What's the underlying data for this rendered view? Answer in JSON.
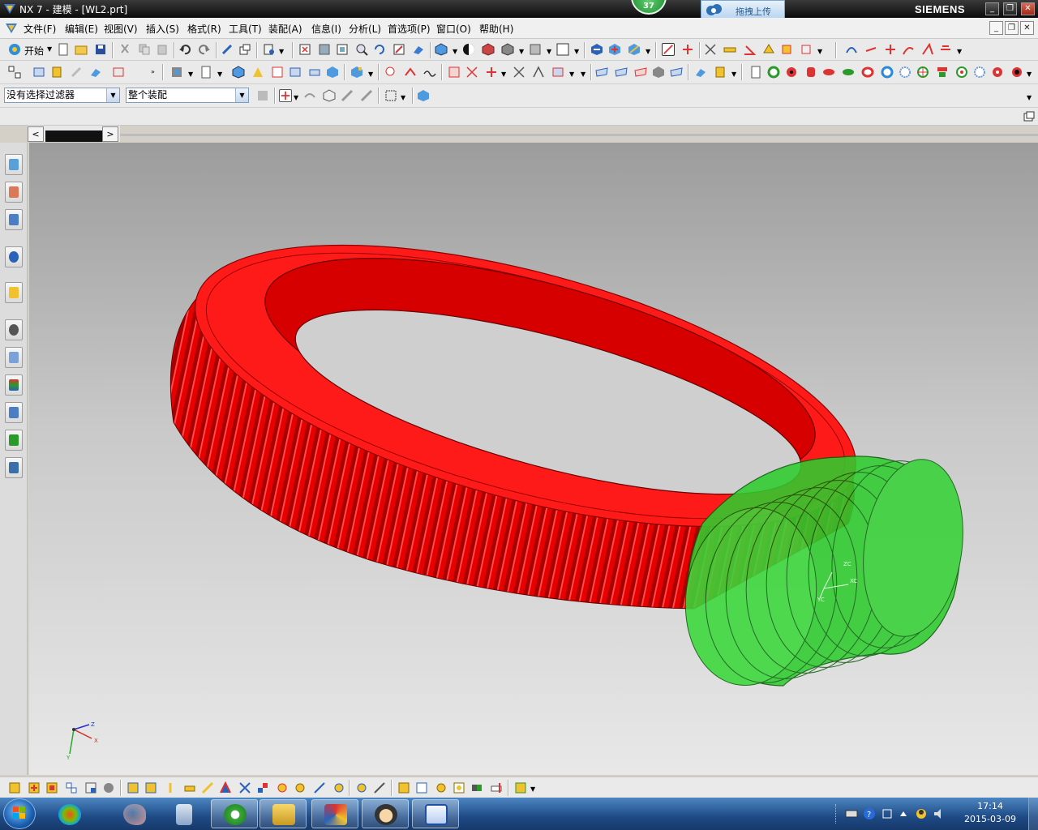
{
  "window": {
    "title": "NX 7 - 建模 - [WL2.prt]",
    "brand": "SIEMENS",
    "notification_count": "37",
    "upload_label": "拖拽上传",
    "controls": {
      "minimize": "_",
      "restore": "❐",
      "close": "✕"
    }
  },
  "menubar": {
    "items": [
      "文件(F)",
      "编辑(E)",
      "视图(V)",
      "插入(S)",
      "格式(R)",
      "工具(T)",
      "装配(A)",
      "信息(I)",
      "分析(L)",
      "首选项(P)",
      "窗口(O)",
      "帮助(H)"
    ],
    "mdi": {
      "minimize": "_",
      "restore": "❐",
      "close": "✕"
    }
  },
  "toolbar1": {
    "start_label": "开始"
  },
  "toolbar3": {
    "filter_value": "没有选择过滤器",
    "scope_value": "整个装配"
  },
  "navbar": {
    "left": "<",
    "right": ">"
  },
  "viewport": {
    "ring_color": "#ff1a1a",
    "worm_color": "#2ecc2e",
    "background_top": "#9c9c9c",
    "background_bottom": "#e8e8e8",
    "triad": {
      "z": "Z",
      "x": "X",
      "y": "Y"
    },
    "wcs": {
      "zc": "ZC",
      "xc": "XC",
      "yc": "YC"
    }
  },
  "taskbar": {
    "time": "17:14",
    "date": "2015-03-09",
    "apps": [
      "explorer",
      "paint",
      "calculator",
      "ie-browser",
      "file-manager",
      "nx",
      "avatar-app",
      "word"
    ]
  }
}
